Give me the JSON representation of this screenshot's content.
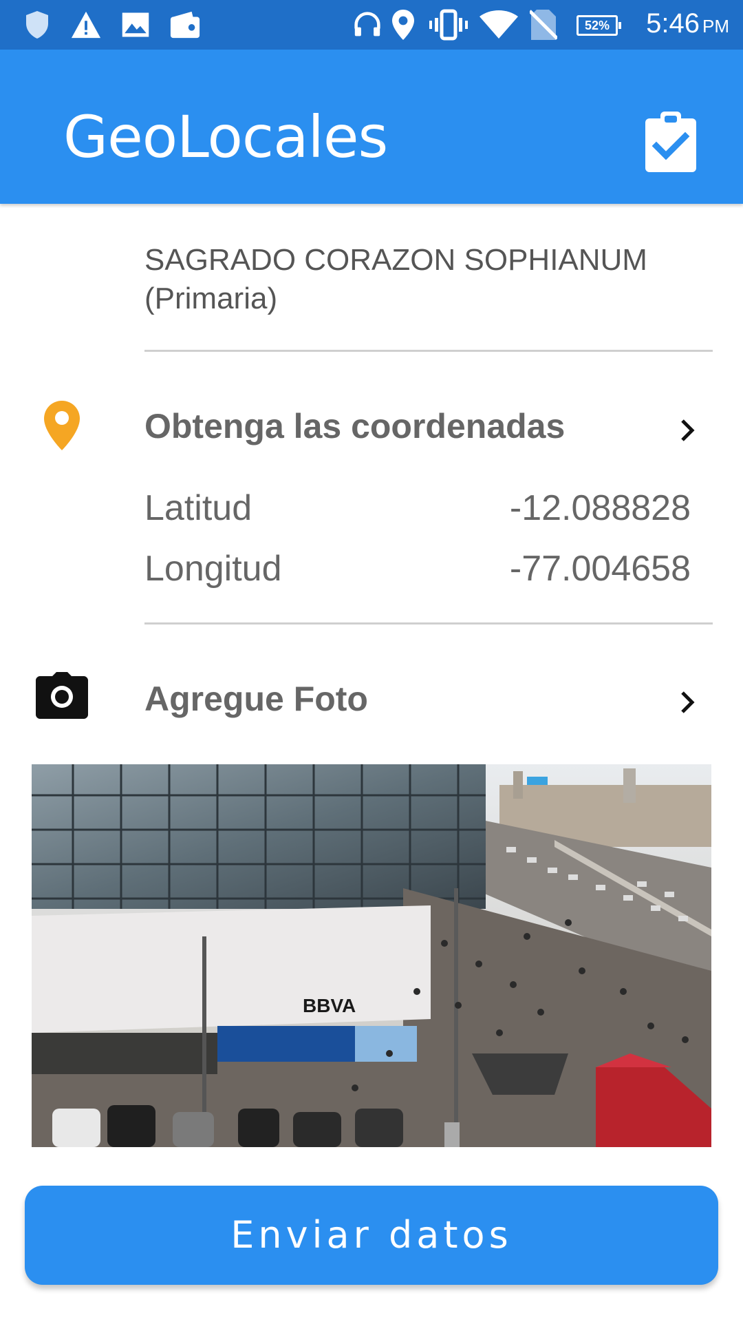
{
  "status_bar": {
    "time": "5:46",
    "ampm": "PM",
    "battery": "52%",
    "icons": [
      "shield-icon",
      "warning-icon",
      "image-icon",
      "wallet-icon",
      "headset-icon",
      "location-icon",
      "vibrate-icon",
      "wifi-icon",
      "no-sim-icon",
      "battery-icon"
    ]
  },
  "app_bar": {
    "title": "GeoLocales",
    "action_icon": "clipboard-check-icon"
  },
  "school": {
    "name": "SAGRADO CORAZON SOPHIANUM",
    "level": "(Primaria)"
  },
  "coordinates": {
    "title": "Obtenga las coordenadas",
    "icon": "location-pin-icon",
    "latitude_label": "Latitud",
    "latitude_value": "-12.088828",
    "longitude_label": "Longitud",
    "longitude_value": "-77.004658"
  },
  "photo_section": {
    "title": "Agregue Foto",
    "icon": "camera-icon",
    "photo_sign": "BBVA"
  },
  "send_button": {
    "label": "Enviar datos"
  },
  "colors": {
    "status_bar": "#1f6fc8",
    "app_bar": "#2b8ff0",
    "pin": "#f5a623",
    "button": "#2b8ff0"
  }
}
